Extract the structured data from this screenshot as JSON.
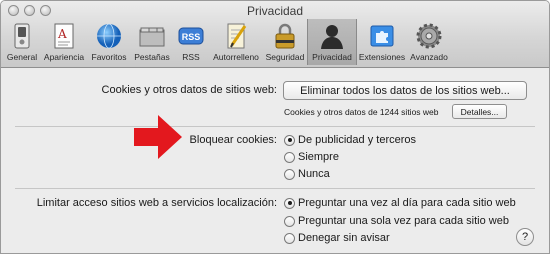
{
  "window": {
    "title": "Privacidad"
  },
  "toolbar": {
    "items": [
      {
        "label": "General",
        "icon": "general-switch-icon"
      },
      {
        "label": "Apariencia",
        "icon": "appearance-icon"
      },
      {
        "label": "Favoritos",
        "icon": "globe-icon"
      },
      {
        "label": "Pestañas",
        "icon": "tabs-icon"
      },
      {
        "label": "RSS",
        "icon": "rss-icon"
      },
      {
        "label": "Autorrelleno",
        "icon": "autofill-pencil-icon"
      },
      {
        "label": "Seguridad",
        "icon": "lock-icon"
      },
      {
        "label": "Privacidad",
        "icon": "person-silhouette-icon",
        "selected": true
      },
      {
        "label": "Extensiones",
        "icon": "puzzle-icon"
      },
      {
        "label": "Avanzado",
        "icon": "gear-icon"
      }
    ]
  },
  "cookies": {
    "label": "Cookies y otros datos de sitios web:",
    "remove_button": "Eliminar todos los datos de los sitios web...",
    "count_text": "Cookies y otros datos de 1244 sitios web",
    "details_button": "Detalles..."
  },
  "block": {
    "label": "Bloquear cookies:",
    "options": [
      "De publicidad y terceros",
      "Siempre",
      "Nunca"
    ],
    "selected_index": 0
  },
  "location": {
    "label": "Limitar acceso sitios web a servicios localización:",
    "options": [
      "Preguntar una vez al día para cada sitio web",
      "Preguntar una sola vez para cada sitio web",
      "Denegar sin avisar"
    ],
    "selected_index": 0
  },
  "help": {
    "label": "?"
  },
  "colors": {
    "arrow": "#e3181e",
    "selected_tab": "#b2b2b2"
  }
}
